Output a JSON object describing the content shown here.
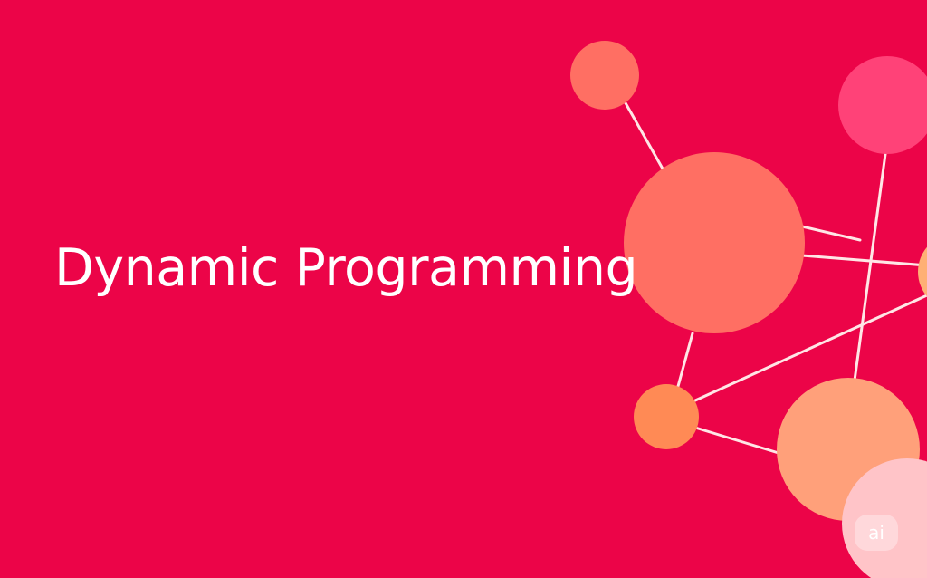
{
  "title": "Dynamic Programming",
  "badge_label": "ai",
  "colors": {
    "background": "#EC0448",
    "title_text": "#FFFFFF",
    "connector_line": "#FFE6E6",
    "node_coral": "#FF6F63",
    "node_pink": "#FF4278",
    "node_orange": "#FF8A55",
    "node_peach": "#FFA07A",
    "node_light_pink": "#FFC4C8",
    "node_edge_orange": "#FFB074"
  },
  "network": {
    "nodes": [
      {
        "id": "node-top-small",
        "color": "node_coral"
      },
      {
        "id": "node-top-right",
        "color": "node_pink"
      },
      {
        "id": "node-large-center",
        "color": "node_coral"
      },
      {
        "id": "node-right-edge",
        "color": "node_edge_orange"
      },
      {
        "id": "node-small-bottom",
        "color": "node_orange"
      },
      {
        "id": "node-bottom-large",
        "color": "node_peach"
      },
      {
        "id": "node-bottom-right",
        "color": "node_light_pink"
      }
    ]
  }
}
